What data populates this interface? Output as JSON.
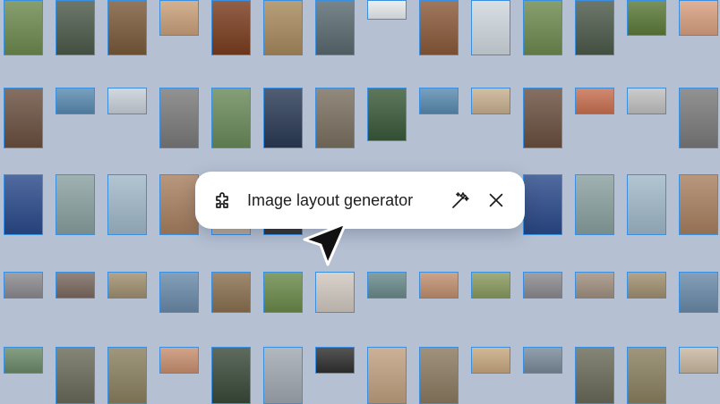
{
  "toolbar": {
    "title": "Image layout generator",
    "icons": [
      "puzzle-icon",
      "magic-wand-icon",
      "close-icon"
    ]
  },
  "cursor": {
    "icon": "pointer-arrow-icon"
  },
  "colors": {
    "background": "#b5c0d3",
    "thumb_border": "#3b8fe0",
    "toolbar_bg": "#ffffff",
    "text": "#1e1e1e"
  },
  "thumbnails": [
    {
      "c": "#6d8a4f"
    },
    {
      "c": "#4c5a4a"
    },
    {
      "c": "#7a5a3a"
    },
    {
      "c": "#c9a07a"
    },
    {
      "c": "#7a3d1f"
    },
    {
      "c": "#a88a5e"
    },
    {
      "c": "#5a6a70"
    },
    {
      "c": "#e8ecef"
    },
    {
      "c": "#8a5a3a"
    },
    {
      "c": "#d0d8de"
    },
    {
      "c": "#6d8a4f"
    },
    {
      "c": "#4c5a4a"
    },
    {
      "c": "#5c7a3a"
    },
    {
      "c": "#d8a080"
    },
    {
      "c": "#6a5040"
    },
    {
      "c": "#5a8ab0"
    },
    {
      "c": "#c8d0d8"
    },
    {
      "c": "#7a7a7a"
    },
    {
      "c": "#6a8a5a"
    },
    {
      "c": "#2a3a55"
    },
    {
      "c": "#7a7060"
    },
    {
      "c": "#3a5a3a"
    },
    {
      "c": "#5a8ab0"
    },
    {
      "c": "#c8b090"
    },
    {
      "c": "#6a5040"
    },
    {
      "c": "#c87050"
    },
    {
      "c": "#c0c0c0"
    },
    {
      "c": "#7a7a7a"
    },
    {
      "c": "#2a4a8a"
    },
    {
      "c": "#8aa0a0"
    },
    {
      "c": "#a0b8c8"
    },
    {
      "c": "#a88060"
    },
    {
      "c": "#d0c0b0"
    },
    {
      "c": "#3a3a3a"
    },
    {
      "c": "#2a4a8a"
    },
    {
      "c": "#8aa0a0"
    },
    {
      "c": "#a0b8c8"
    },
    {
      "c": "#a88060"
    },
    {
      "c": "#8a8a90"
    },
    {
      "c": "#7a6a60"
    },
    {
      "c": "#a09070"
    },
    {
      "c": "#6a8aa8"
    },
    {
      "c": "#8a7050"
    },
    {
      "c": "#6a8a4a"
    },
    {
      "c": "#d0c8c0"
    },
    {
      "c": "#6a8a8a"
    },
    {
      "c": "#c09070"
    },
    {
      "c": "#8a9a60"
    },
    {
      "c": "#8a8a90"
    },
    {
      "c": "#a09080"
    },
    {
      "c": "#a09070"
    },
    {
      "c": "#6a8aa8"
    },
    {
      "c": "#6a8a6a"
    },
    {
      "c": "#6a6a5a"
    },
    {
      "c": "#8a8060"
    },
    {
      "c": "#c89070"
    },
    {
      "c": "#3a4a3a"
    },
    {
      "c": "#a0a8b0"
    },
    {
      "c": "#303030"
    },
    {
      "c": "#c0a080"
    },
    {
      "c": "#8a7a60"
    },
    {
      "c": "#c8a880"
    },
    {
      "c": "#7a8a9a"
    },
    {
      "c": "#6a6a5a"
    },
    {
      "c": "#8a8060"
    },
    {
      "c": "#c8b8a0"
    },
    {
      "c": "#c8b090"
    }
  ]
}
